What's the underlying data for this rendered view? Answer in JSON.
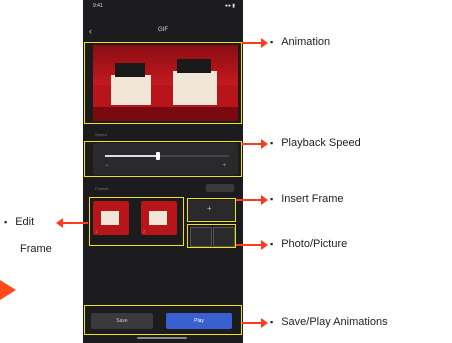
{
  "app": {
    "status_time": "9:41",
    "status_icons": "●● ▮",
    "back_icon": "chevron-left-icon",
    "title": "GIF"
  },
  "speed": {
    "section_label": "Speed",
    "minus": "−",
    "plus": "+",
    "level": 0.4
  },
  "frames": {
    "section_label": "Frames",
    "items": [
      {
        "num": "1"
      },
      {
        "num": "2"
      }
    ],
    "insert_symbol": "+"
  },
  "actions": {
    "save_label": "Save",
    "play_label": "Play"
  },
  "annotations": {
    "animation": "Animation",
    "playback_speed": "Playback Speed",
    "insert_frame": "Insert Frame",
    "photo_picture": "Photo/Picture",
    "save_play": "Save/Play Animations",
    "edit_line1": "Edit",
    "edit_line2": "Frame",
    "bullet": "▪"
  },
  "colors": {
    "highlight": "#f0e020",
    "arrow": "#ff3b1f",
    "phone_bg": "#1c1c1e",
    "play_accent": "#3a5fd0"
  }
}
